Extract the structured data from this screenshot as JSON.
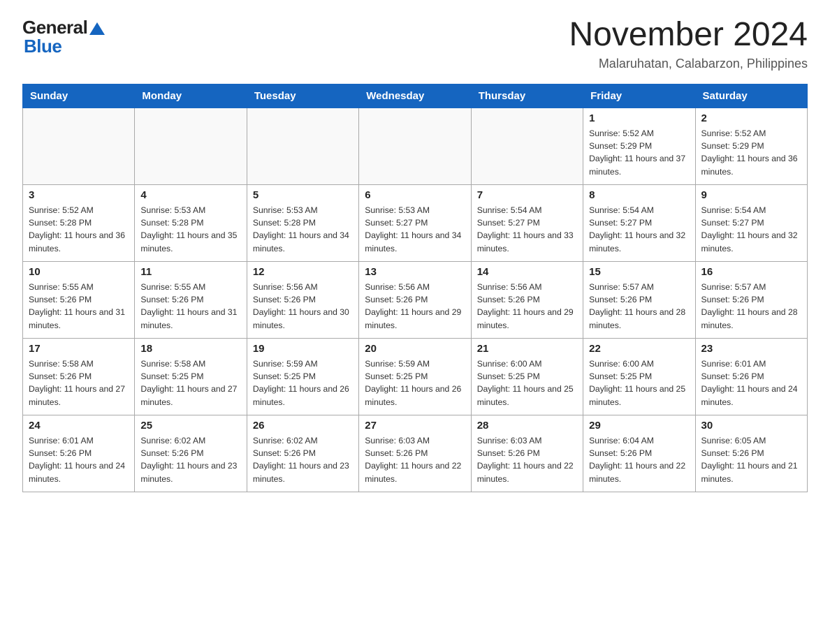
{
  "header": {
    "logo_general": "General",
    "logo_blue": "Blue",
    "month_title": "November 2024",
    "location": "Malaruhatan, Calabarzon, Philippines"
  },
  "days_of_week": [
    "Sunday",
    "Monday",
    "Tuesday",
    "Wednesday",
    "Thursday",
    "Friday",
    "Saturday"
  ],
  "weeks": [
    [
      {
        "day": "",
        "sunrise": "",
        "sunset": "",
        "daylight": ""
      },
      {
        "day": "",
        "sunrise": "",
        "sunset": "",
        "daylight": ""
      },
      {
        "day": "",
        "sunrise": "",
        "sunset": "",
        "daylight": ""
      },
      {
        "day": "",
        "sunrise": "",
        "sunset": "",
        "daylight": ""
      },
      {
        "day": "",
        "sunrise": "",
        "sunset": "",
        "daylight": ""
      },
      {
        "day": "1",
        "sunrise": "Sunrise: 5:52 AM",
        "sunset": "Sunset: 5:29 PM",
        "daylight": "Daylight: 11 hours and 37 minutes."
      },
      {
        "day": "2",
        "sunrise": "Sunrise: 5:52 AM",
        "sunset": "Sunset: 5:29 PM",
        "daylight": "Daylight: 11 hours and 36 minutes."
      }
    ],
    [
      {
        "day": "3",
        "sunrise": "Sunrise: 5:52 AM",
        "sunset": "Sunset: 5:28 PM",
        "daylight": "Daylight: 11 hours and 36 minutes."
      },
      {
        "day": "4",
        "sunrise": "Sunrise: 5:53 AM",
        "sunset": "Sunset: 5:28 PM",
        "daylight": "Daylight: 11 hours and 35 minutes."
      },
      {
        "day": "5",
        "sunrise": "Sunrise: 5:53 AM",
        "sunset": "Sunset: 5:28 PM",
        "daylight": "Daylight: 11 hours and 34 minutes."
      },
      {
        "day": "6",
        "sunrise": "Sunrise: 5:53 AM",
        "sunset": "Sunset: 5:27 PM",
        "daylight": "Daylight: 11 hours and 34 minutes."
      },
      {
        "day": "7",
        "sunrise": "Sunrise: 5:54 AM",
        "sunset": "Sunset: 5:27 PM",
        "daylight": "Daylight: 11 hours and 33 minutes."
      },
      {
        "day": "8",
        "sunrise": "Sunrise: 5:54 AM",
        "sunset": "Sunset: 5:27 PM",
        "daylight": "Daylight: 11 hours and 32 minutes."
      },
      {
        "day": "9",
        "sunrise": "Sunrise: 5:54 AM",
        "sunset": "Sunset: 5:27 PM",
        "daylight": "Daylight: 11 hours and 32 minutes."
      }
    ],
    [
      {
        "day": "10",
        "sunrise": "Sunrise: 5:55 AM",
        "sunset": "Sunset: 5:26 PM",
        "daylight": "Daylight: 11 hours and 31 minutes."
      },
      {
        "day": "11",
        "sunrise": "Sunrise: 5:55 AM",
        "sunset": "Sunset: 5:26 PM",
        "daylight": "Daylight: 11 hours and 31 minutes."
      },
      {
        "day": "12",
        "sunrise": "Sunrise: 5:56 AM",
        "sunset": "Sunset: 5:26 PM",
        "daylight": "Daylight: 11 hours and 30 minutes."
      },
      {
        "day": "13",
        "sunrise": "Sunrise: 5:56 AM",
        "sunset": "Sunset: 5:26 PM",
        "daylight": "Daylight: 11 hours and 29 minutes."
      },
      {
        "day": "14",
        "sunrise": "Sunrise: 5:56 AM",
        "sunset": "Sunset: 5:26 PM",
        "daylight": "Daylight: 11 hours and 29 minutes."
      },
      {
        "day": "15",
        "sunrise": "Sunrise: 5:57 AM",
        "sunset": "Sunset: 5:26 PM",
        "daylight": "Daylight: 11 hours and 28 minutes."
      },
      {
        "day": "16",
        "sunrise": "Sunrise: 5:57 AM",
        "sunset": "Sunset: 5:26 PM",
        "daylight": "Daylight: 11 hours and 28 minutes."
      }
    ],
    [
      {
        "day": "17",
        "sunrise": "Sunrise: 5:58 AM",
        "sunset": "Sunset: 5:26 PM",
        "daylight": "Daylight: 11 hours and 27 minutes."
      },
      {
        "day": "18",
        "sunrise": "Sunrise: 5:58 AM",
        "sunset": "Sunset: 5:25 PM",
        "daylight": "Daylight: 11 hours and 27 minutes."
      },
      {
        "day": "19",
        "sunrise": "Sunrise: 5:59 AM",
        "sunset": "Sunset: 5:25 PM",
        "daylight": "Daylight: 11 hours and 26 minutes."
      },
      {
        "day": "20",
        "sunrise": "Sunrise: 5:59 AM",
        "sunset": "Sunset: 5:25 PM",
        "daylight": "Daylight: 11 hours and 26 minutes."
      },
      {
        "day": "21",
        "sunrise": "Sunrise: 6:00 AM",
        "sunset": "Sunset: 5:25 PM",
        "daylight": "Daylight: 11 hours and 25 minutes."
      },
      {
        "day": "22",
        "sunrise": "Sunrise: 6:00 AM",
        "sunset": "Sunset: 5:25 PM",
        "daylight": "Daylight: 11 hours and 25 minutes."
      },
      {
        "day": "23",
        "sunrise": "Sunrise: 6:01 AM",
        "sunset": "Sunset: 5:26 PM",
        "daylight": "Daylight: 11 hours and 24 minutes."
      }
    ],
    [
      {
        "day": "24",
        "sunrise": "Sunrise: 6:01 AM",
        "sunset": "Sunset: 5:26 PM",
        "daylight": "Daylight: 11 hours and 24 minutes."
      },
      {
        "day": "25",
        "sunrise": "Sunrise: 6:02 AM",
        "sunset": "Sunset: 5:26 PM",
        "daylight": "Daylight: 11 hours and 23 minutes."
      },
      {
        "day": "26",
        "sunrise": "Sunrise: 6:02 AM",
        "sunset": "Sunset: 5:26 PM",
        "daylight": "Daylight: 11 hours and 23 minutes."
      },
      {
        "day": "27",
        "sunrise": "Sunrise: 6:03 AM",
        "sunset": "Sunset: 5:26 PM",
        "daylight": "Daylight: 11 hours and 22 minutes."
      },
      {
        "day": "28",
        "sunrise": "Sunrise: 6:03 AM",
        "sunset": "Sunset: 5:26 PM",
        "daylight": "Daylight: 11 hours and 22 minutes."
      },
      {
        "day": "29",
        "sunrise": "Sunrise: 6:04 AM",
        "sunset": "Sunset: 5:26 PM",
        "daylight": "Daylight: 11 hours and 22 minutes."
      },
      {
        "day": "30",
        "sunrise": "Sunrise: 6:05 AM",
        "sunset": "Sunset: 5:26 PM",
        "daylight": "Daylight: 11 hours and 21 minutes."
      }
    ]
  ]
}
